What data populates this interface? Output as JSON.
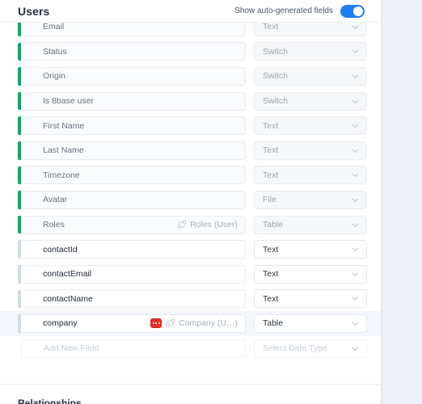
{
  "header": {
    "title": "Users",
    "toggle_label": "Show auto-generated fields",
    "toggle_state": "on",
    "toggle_color": "#1f7ef6"
  },
  "colors": {
    "auto_indicator": "#07ad63",
    "custom_indicator": "#d3dae2",
    "badge_red": "#e8302a",
    "page_background": "#eef1f5"
  },
  "fields": [
    {
      "name": "Email",
      "kind": "auto",
      "type": "Text",
      "relation": "",
      "badge": false,
      "highlighted": false,
      "clipped": true
    },
    {
      "name": "Status",
      "kind": "auto",
      "type": "Switch",
      "relation": "",
      "badge": false,
      "highlighted": false,
      "clipped": false
    },
    {
      "name": "Origin",
      "kind": "auto",
      "type": "Switch",
      "relation": "",
      "badge": false,
      "highlighted": false,
      "clipped": false
    },
    {
      "name": "Is 8base user",
      "kind": "auto",
      "type": "Switch",
      "relation": "",
      "badge": false,
      "highlighted": false,
      "clipped": false
    },
    {
      "name": "First Name",
      "kind": "auto",
      "type": "Text",
      "relation": "",
      "badge": false,
      "highlighted": false,
      "clipped": false
    },
    {
      "name": "Last Name",
      "kind": "auto",
      "type": "Text",
      "relation": "",
      "badge": false,
      "highlighted": false,
      "clipped": false
    },
    {
      "name": "Timezone",
      "kind": "auto",
      "type": "Text",
      "relation": "",
      "badge": false,
      "highlighted": false,
      "clipped": false
    },
    {
      "name": "Avatar",
      "kind": "auto",
      "type": "File",
      "relation": "",
      "badge": false,
      "highlighted": false,
      "clipped": false
    },
    {
      "name": "Roles",
      "kind": "auto",
      "type": "Table",
      "relation": "Roles (User)",
      "badge": false,
      "highlighted": false,
      "clipped": false
    },
    {
      "name": "contactId",
      "kind": "custom",
      "type": "Text",
      "relation": "",
      "badge": false,
      "highlighted": false,
      "clipped": false
    },
    {
      "name": "contactEmail",
      "kind": "custom",
      "type": "Text",
      "relation": "",
      "badge": false,
      "highlighted": false,
      "clipped": false
    },
    {
      "name": "contactName",
      "kind": "custom",
      "type": "Text",
      "relation": "",
      "badge": false,
      "highlighted": false,
      "clipped": false
    },
    {
      "name": "company",
      "kind": "custom",
      "type": "Table",
      "relation": "Company (U…)",
      "badge": true,
      "highlighted": true,
      "clipped": false
    }
  ],
  "add_row": {
    "name_placeholder": "Add New Field",
    "type_placeholder": "Select Data Type"
  },
  "sections": {
    "relationships_heading": "Relationships"
  }
}
